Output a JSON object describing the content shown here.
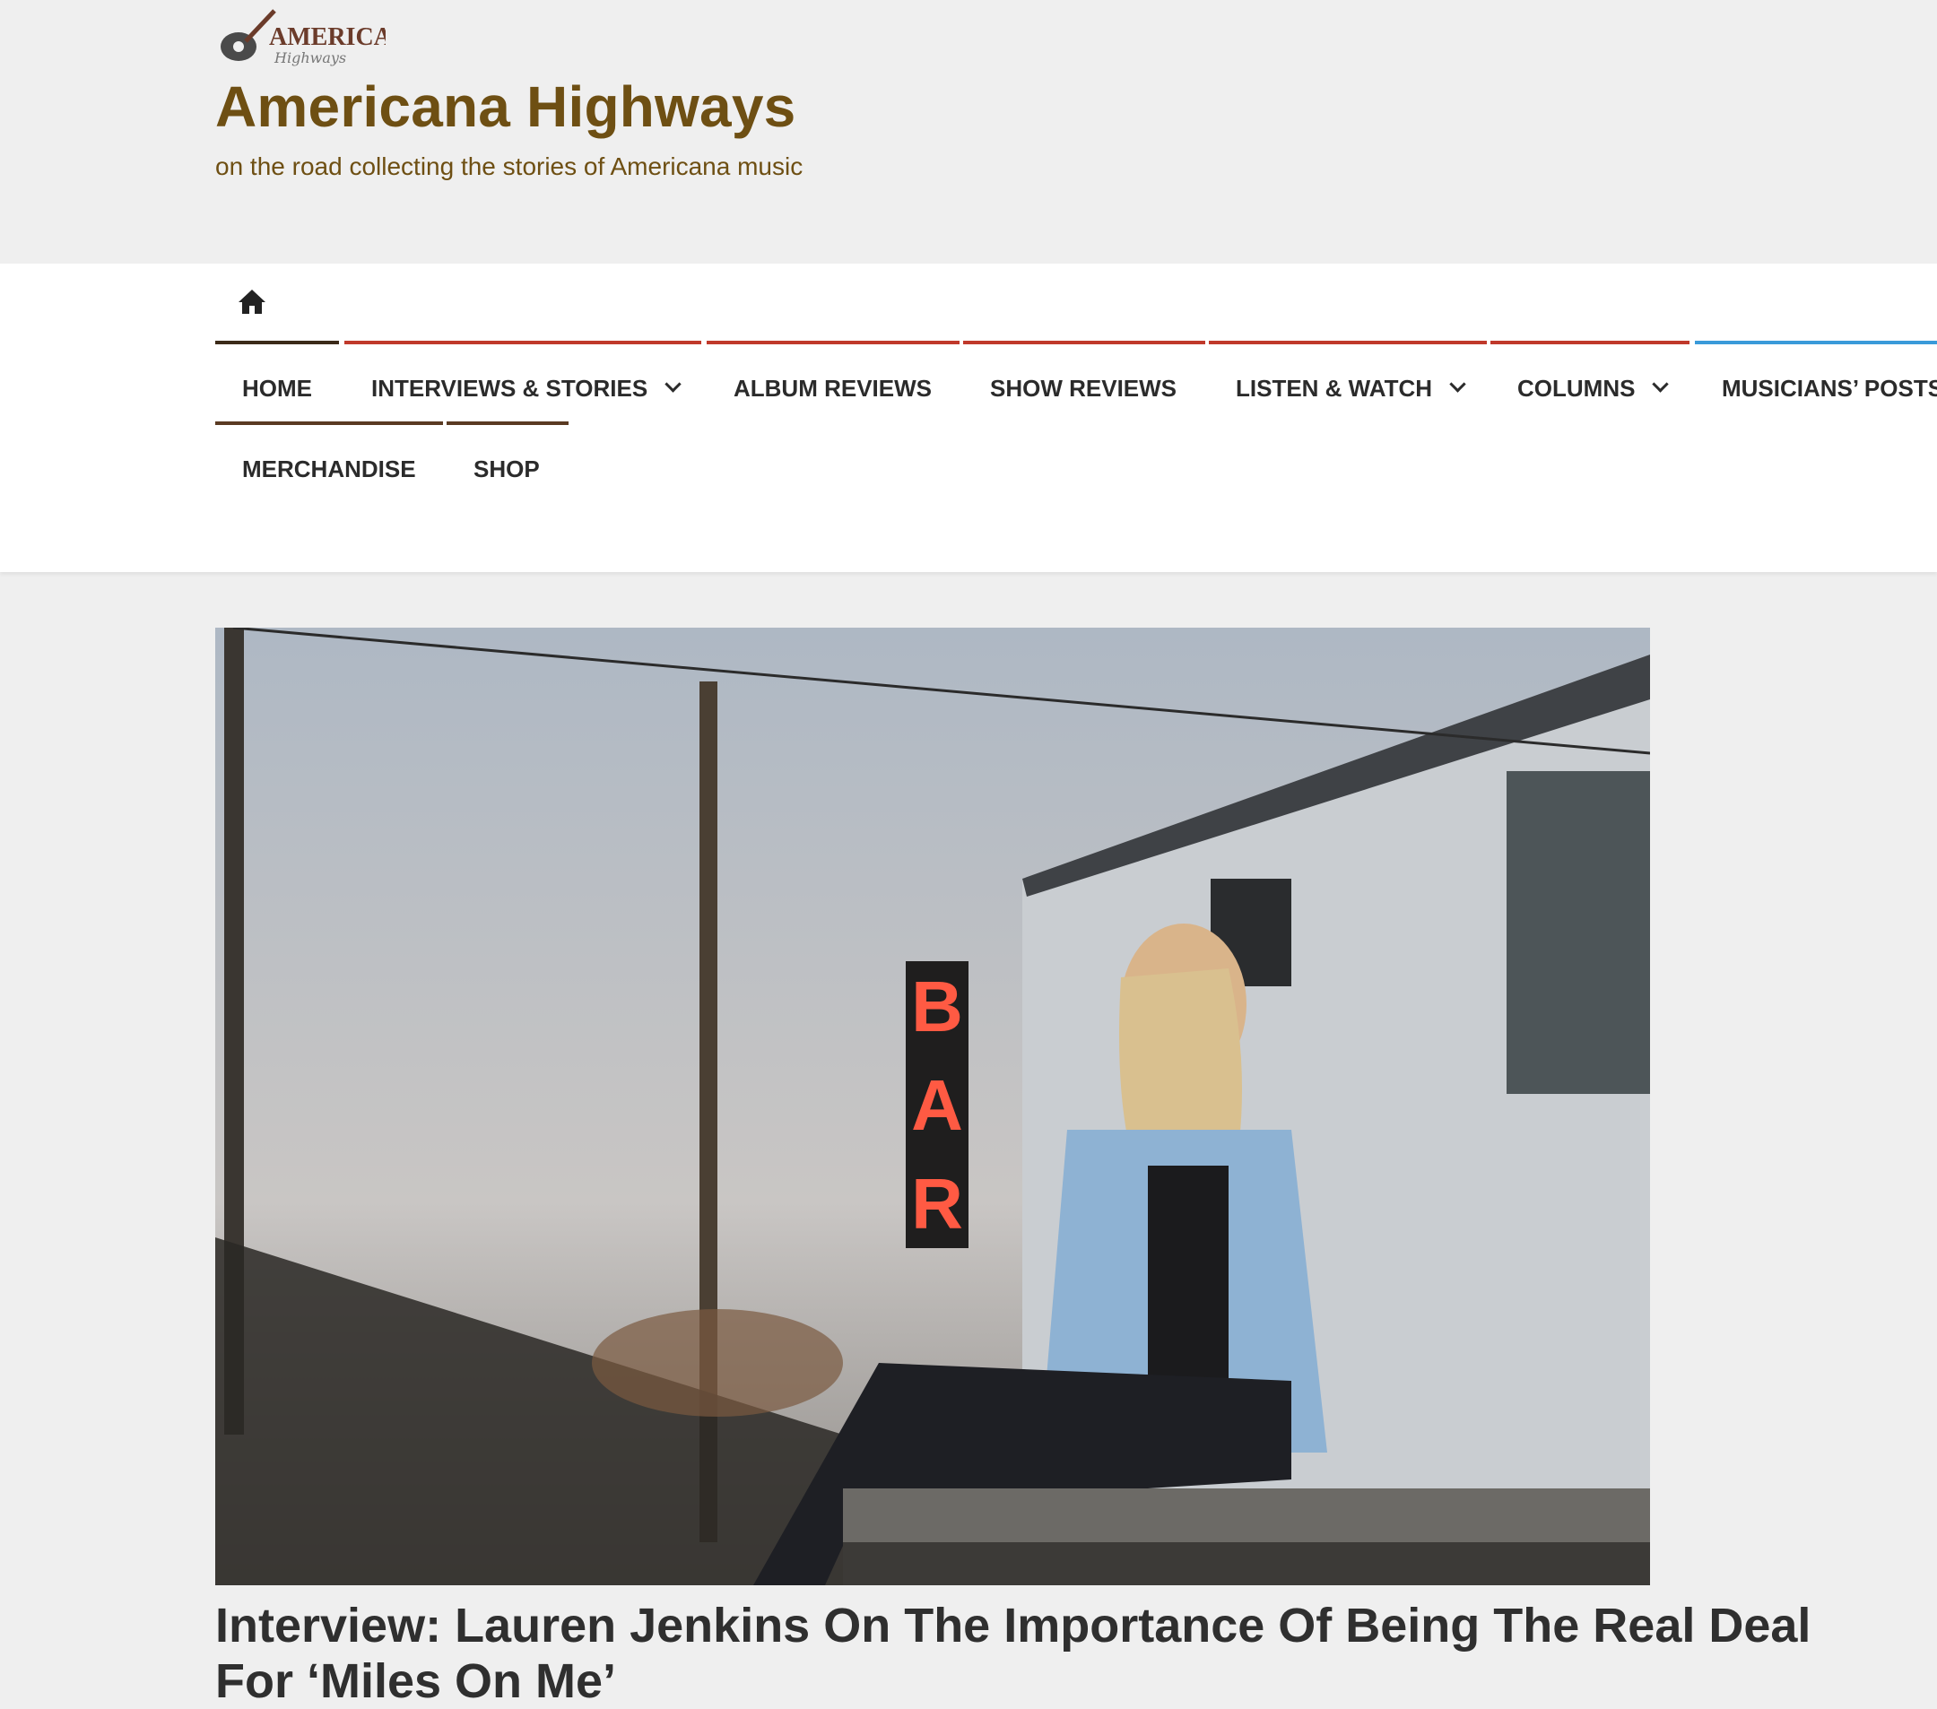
{
  "site": {
    "logo_text": "AMERICANA",
    "logo_subtext": "Highways",
    "title": "Americana Highways",
    "tagline": "on the road collecting the stories of Americana music"
  },
  "nav": {
    "home_icon": "home-icon",
    "items": [
      {
        "label": "HOME",
        "accent": "#3b2a18",
        "has_dropdown": false
      },
      {
        "label": "INTERVIEWS & STORIES",
        "accent": "#c0392b",
        "has_dropdown": true
      },
      {
        "label": "ALBUM REVIEWS",
        "accent": "#c0392b",
        "has_dropdown": false
      },
      {
        "label": "SHOW REVIEWS",
        "accent": "#c0392b",
        "has_dropdown": false
      },
      {
        "label": "LISTEN & WATCH",
        "accent": "#c0392b",
        "has_dropdown": true
      },
      {
        "label": "COLUMNS",
        "accent": "#c0392b",
        "has_dropdown": true
      },
      {
        "label": "MUSICIANS’ POSTS",
        "accent": "#3a9ad9",
        "has_dropdown": false
      },
      {
        "label": "MERCHANDISE",
        "accent": "#5a3a22",
        "has_dropdown": false
      },
      {
        "label": "SHOP",
        "accent": "#5a3a22",
        "has_dropdown": false
      }
    ]
  },
  "post": {
    "sign_text": "BAR",
    "title": "Interview: Lauren Jenkins On The Importance Of Being The Real Deal For ‘Miles On Me’"
  },
  "colors": {
    "brand_brown": "#6e4f13",
    "page_bg": "#efefef",
    "nav_red": "#c0392b",
    "nav_blue": "#3a9ad9"
  }
}
